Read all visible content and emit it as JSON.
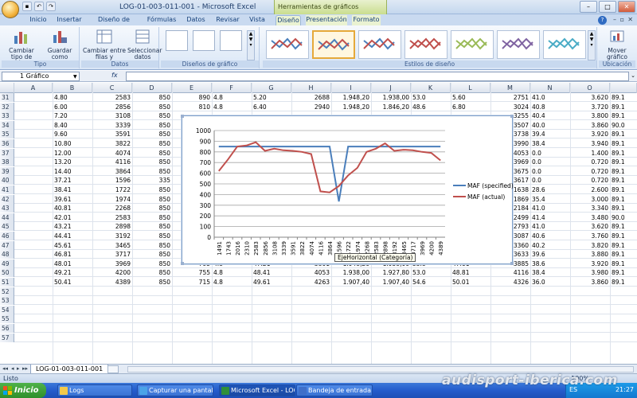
{
  "window": {
    "title": "LOG-01-003-011-001 - Microsoft Excel",
    "context_tools": "Herramientas de gráficos",
    "qat": [
      "save-icon",
      "undo-icon",
      "redo-icon"
    ]
  },
  "tabs": [
    {
      "label": "Inicio"
    },
    {
      "label": "Insertar"
    },
    {
      "label": "Diseño de página"
    },
    {
      "label": "Fórmulas"
    },
    {
      "label": "Datos"
    },
    {
      "label": "Revisar"
    },
    {
      "label": "Vista"
    },
    {
      "label": "Diseño"
    },
    {
      "label": "Presentación"
    },
    {
      "label": "Formato"
    }
  ],
  "ribbon": {
    "tipo": {
      "label": "Tipo",
      "buttons": [
        "Cambiar tipo de gráfico",
        "Guardar como plantilla"
      ]
    },
    "datos": {
      "label": "Datos",
      "buttons": [
        "Cambiar entre filas y columnas",
        "Seleccionar datos"
      ]
    },
    "disenos": {
      "label": "Diseños de gráfico"
    },
    "estilos": {
      "label": "Estilos de diseño"
    },
    "ubicacion": {
      "label": "Ubicación",
      "buttons": [
        "Mover gráfico"
      ]
    }
  },
  "formula_bar": {
    "name_box": "1 Gráfico",
    "fx": "fx",
    "value": ""
  },
  "columns": [
    "A",
    "B",
    "C",
    "D",
    "E",
    "F",
    "G",
    "H",
    "I",
    "J",
    "K",
    "L",
    "M",
    "N",
    "O"
  ],
  "rows": [
    {
      "n": "31",
      "B": "4.80",
      "C": "2583",
      "D": "850",
      "E": "890",
      "F": "4.8",
      "G": "5.20",
      "H": "2688",
      "I": "1.948,20",
      "J": "1.938,00",
      "K": "53.0",
      "L": "5.60",
      "M": "2751",
      "N": "41.0",
      "O": "3.620",
      "P": "89.1"
    },
    {
      "n": "32",
      "B": "6.00",
      "C": "2856",
      "D": "850",
      "E": "810",
      "F": "4.8",
      "G": "6.40",
      "H": "2940",
      "I": "1.948,20",
      "J": "1.846,20",
      "K": "48.6",
      "L": "6.80",
      "M": "3024",
      "N": "40.8",
      "O": "3.720",
      "P": "89.1"
    },
    {
      "n": "33",
      "B": "7.20",
      "C": "3108",
      "D": "850",
      "E": "",
      "F": "",
      "G": "",
      "H": "",
      "I": "",
      "J": "",
      "K": "",
      "L": "",
      "M": "3255",
      "N": "40.4",
      "O": "3.800",
      "P": "89.1"
    },
    {
      "n": "34",
      "B": "8.40",
      "C": "3339",
      "D": "850",
      "E": "",
      "F": "",
      "G": "",
      "H": "",
      "I": "",
      "J": "",
      "K": "",
      "L": "",
      "M": "3507",
      "N": "40.0",
      "O": "3.860",
      "P": "90.0"
    },
    {
      "n": "35",
      "B": "9.60",
      "C": "3591",
      "D": "850",
      "E": "",
      "F": "",
      "G": "",
      "H": "",
      "I": "",
      "J": "",
      "K": "",
      "L": "",
      "M": "3738",
      "N": "39.4",
      "O": "3.920",
      "P": "89.1"
    },
    {
      "n": "36",
      "B": "10.80",
      "C": "3822",
      "D": "850",
      "E": "",
      "F": "",
      "G": "",
      "H": "",
      "I": "",
      "J": "",
      "K": "",
      "L": "",
      "M": "3990",
      "N": "38.4",
      "O": "3.940",
      "P": "89.1"
    },
    {
      "n": "37",
      "B": "12.00",
      "C": "4074",
      "D": "850",
      "E": "",
      "F": "",
      "G": "",
      "H": "",
      "I": "",
      "J": "",
      "K": "",
      "L": "",
      "M": "4053",
      "N": "0.0",
      "O": "1.400",
      "P": "89.1"
    },
    {
      "n": "38",
      "B": "13.20",
      "C": "4116",
      "D": "850",
      "E": "",
      "F": "",
      "G": "",
      "H": "",
      "I": "",
      "J": "",
      "K": "",
      "L": "",
      "M": "3969",
      "N": "0.0",
      "O": "0.720",
      "P": "89.1"
    },
    {
      "n": "39",
      "B": "14.40",
      "C": "3864",
      "D": "850",
      "E": "",
      "F": "",
      "G": "",
      "H": "",
      "I": "",
      "J": "",
      "K": "",
      "L": "",
      "M": "3675",
      "N": "0.0",
      "O": "0.720",
      "P": "89.1"
    },
    {
      "n": "40",
      "B": "37.21",
      "C": "1596",
      "D": "335",
      "E": "",
      "F": "",
      "G": "",
      "H": "",
      "I": "",
      "J": "",
      "K": "",
      "L": "",
      "M": "3617",
      "N": "0.0",
      "O": "0.720",
      "P": "89.1"
    },
    {
      "n": "41",
      "B": "38.41",
      "C": "1722",
      "D": "850",
      "E": "",
      "F": "",
      "G": "",
      "H": "",
      "I": "",
      "J": "",
      "K": "",
      "L": "",
      "M": "1638",
      "N": "28.6",
      "O": "2.600",
      "P": "89.1"
    },
    {
      "n": "42",
      "B": "39.61",
      "C": "1974",
      "D": "850",
      "E": "",
      "F": "",
      "G": "",
      "H": "",
      "I": "",
      "J": "",
      "K": "",
      "L": "",
      "M": "1869",
      "N": "35.4",
      "O": "3.000",
      "P": "89.1"
    },
    {
      "n": "43",
      "B": "40.81",
      "C": "2268",
      "D": "850",
      "E": "",
      "F": "",
      "G": "",
      "H": "",
      "I": "",
      "J": "",
      "K": "",
      "L": "",
      "M": "2184",
      "N": "41.0",
      "O": "3.340",
      "P": "89.1"
    },
    {
      "n": "44",
      "B": "42.01",
      "C": "2583",
      "D": "850",
      "E": "",
      "F": "",
      "G": "",
      "H": "",
      "I": "",
      "J": "",
      "K": "",
      "L": "",
      "M": "2499",
      "N": "41.4",
      "O": "3.480",
      "P": "90.0"
    },
    {
      "n": "45",
      "B": "43.21",
      "C": "2898",
      "D": "850",
      "E": "",
      "F": "",
      "G": "",
      "H": "",
      "I": "",
      "J": "",
      "K": "",
      "L": "",
      "M": "2793",
      "N": "41.0",
      "O": "3.620",
      "P": "89.1"
    },
    {
      "n": "46",
      "B": "44.41",
      "C": "3192",
      "D": "850",
      "E": "",
      "F": "",
      "G": "",
      "H": "",
      "I": "",
      "J": "",
      "K": "",
      "L": "",
      "M": "3087",
      "N": "40.6",
      "O": "3.760",
      "P": "89.1"
    },
    {
      "n": "47",
      "B": "45.61",
      "C": "3465",
      "D": "850",
      "E": "",
      "F": "",
      "G": "",
      "H": "",
      "I": "",
      "J": "",
      "K": "",
      "L": "",
      "M": "3360",
      "N": "40.2",
      "O": "3.820",
      "P": "89.1"
    },
    {
      "n": "48",
      "B": "46.81",
      "C": "3717",
      "D": "850",
      "E": "805",
      "F": "4.8",
      "G": "46.01",
      "H": "3549",
      "I": "1.948,20",
      "J": "1.938,00",
      "K": "53.8",
      "L": "46.41",
      "M": "3633",
      "N": "39.6",
      "O": "3.880",
      "P": "89.1"
    },
    {
      "n": "49",
      "B": "48.01",
      "C": "3969",
      "D": "850",
      "E": "795",
      "F": "4.8",
      "G": "47.21",
      "H": "3801",
      "I": "1.948,20",
      "J": "1.938,00",
      "K": "53.8",
      "L": "47.61",
      "M": "3885",
      "N": "38.6",
      "O": "3.920",
      "P": "89.1"
    },
    {
      "n": "50",
      "B": "49.21",
      "C": "4200",
      "D": "850",
      "E": "755",
      "F": "4.8",
      "G": "48.41",
      "H": "4053",
      "I": "1.938,00",
      "J": "1.927,80",
      "K": "53.0",
      "L": "48.81",
      "M": "4116",
      "N": "38.4",
      "O": "3.980",
      "P": "89.1"
    },
    {
      "n": "51",
      "B": "50.41",
      "C": "4389",
      "D": "850",
      "E": "715",
      "F": "4.8",
      "G": "49.61",
      "H": "4263",
      "I": "1.907,40",
      "J": "1.907,40",
      "K": "54.6",
      "L": "50.01",
      "M": "4326",
      "N": "36.0",
      "O": "3.860",
      "P": "89.1"
    },
    {
      "n": "52"
    },
    {
      "n": "53"
    },
    {
      "n": "54"
    },
    {
      "n": "55"
    },
    {
      "n": "56"
    },
    {
      "n": "57"
    }
  ],
  "chart_data": {
    "type": "line",
    "categories": [
      "1491",
      "1743",
      "2016",
      "2310",
      "2583",
      "2856",
      "3108",
      "3339",
      "3591",
      "3822",
      "4074",
      "4116",
      "3864",
      "1596",
      "1722",
      "1974",
      "2268",
      "2583",
      "2898",
      "3192",
      "3465",
      "3717",
      "3969",
      "4200",
      "4389"
    ],
    "series": [
      {
        "name": "MAF (specified)",
        "color": "#4a7ebb",
        "values": [
          850,
          850,
          850,
          850,
          850,
          850,
          850,
          850,
          850,
          850,
          850,
          850,
          850,
          335,
          850,
          850,
          850,
          850,
          850,
          850,
          850,
          850,
          850,
          850,
          850
        ]
      },
      {
        "name": "MAF (actual)",
        "color": "#c0504d",
        "values": [
          620,
          730,
          850,
          860,
          890,
          810,
          830,
          815,
          810,
          800,
          780,
          430,
          420,
          480,
          580,
          650,
          800,
          830,
          880,
          810,
          820,
          815,
          800,
          790,
          720
        ]
      }
    ],
    "ylim": [
      0,
      1000
    ],
    "yticks": [
      "0",
      "100",
      "200",
      "300",
      "400",
      "500",
      "600",
      "700",
      "800",
      "900",
      "1000"
    ],
    "grid": true,
    "legend": "right",
    "tooltip": "EjeHorizontal (Categoría)"
  },
  "sheet": {
    "tab": "LOG-01-003-011-001"
  },
  "status": {
    "text": "Listo",
    "zoom": "100%"
  },
  "taskbar": {
    "start": "Inicio",
    "tasks": [
      {
        "label": "Logs",
        "icon": "folder-icon"
      },
      {
        "label": "Capturar una pantall...",
        "icon": "browser-icon"
      },
      {
        "label": "Microsoft Excel - LOG...",
        "icon": "excel-icon"
      },
      {
        "label": "Bandeja de entrada - ...",
        "icon": "mail-icon"
      }
    ],
    "lang": "ES",
    "clock": "21:27"
  },
  "watermark": "audisport-iberica.com"
}
